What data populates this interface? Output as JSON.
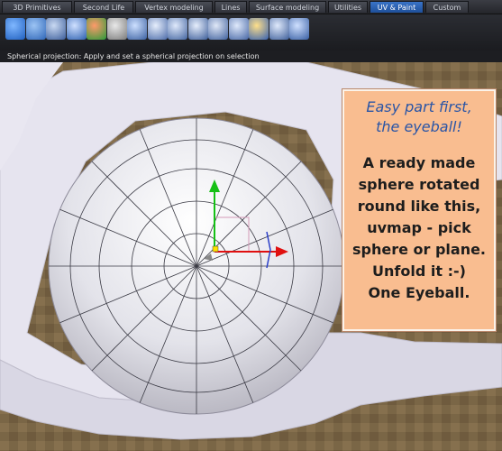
{
  "tabs": [
    {
      "label": "3D Primitives",
      "active": false
    },
    {
      "label": "Second Life",
      "active": false
    },
    {
      "label": "Vertex modeling",
      "active": false
    },
    {
      "label": "Lines",
      "active": false
    },
    {
      "label": "Surface modeling",
      "active": false
    },
    {
      "label": "Utilities",
      "active": false
    },
    {
      "label": "UV & Paint",
      "active": true
    },
    {
      "label": "Custom",
      "active": false
    }
  ],
  "tools": [
    {
      "icon": "spherical-uv-icon"
    },
    {
      "icon": "cylindrical-uv-icon"
    },
    {
      "icon": "planar-uv-icon"
    },
    {
      "icon": "box-uv-icon"
    },
    {
      "icon": "color-sphere-icon"
    },
    {
      "icon": "head-uv-icon"
    },
    {
      "icon": "unfold-icon"
    },
    {
      "icon": "pin-uv-icon"
    },
    {
      "icon": "smooth-uv-icon"
    },
    {
      "icon": "relax-uv-icon"
    },
    {
      "icon": "straighten-uv-icon"
    },
    {
      "icon": "edit-uv-icon"
    },
    {
      "icon": "paint-brush-icon"
    },
    {
      "icon": "uv-cluster-icon"
    },
    {
      "icon": "uv-box-icon"
    }
  ],
  "status_text": "Spherical projection: Apply and set a spherical projection on selection",
  "note": {
    "line1": "Easy part first,",
    "line2": "the eyeball!",
    "body": [
      "A ready made",
      "sphere rotated",
      "round like this,",
      "uvmap - pick",
      "sphere or plane.",
      "Unfold it :-)",
      "One Eyeball."
    ]
  },
  "colors": {
    "accent_tab": "#2f66b8",
    "note_background": "#f9bd90",
    "note_title": "#2a55a6",
    "gizmo_x": "#e01010",
    "gizmo_y": "#15c015"
  }
}
